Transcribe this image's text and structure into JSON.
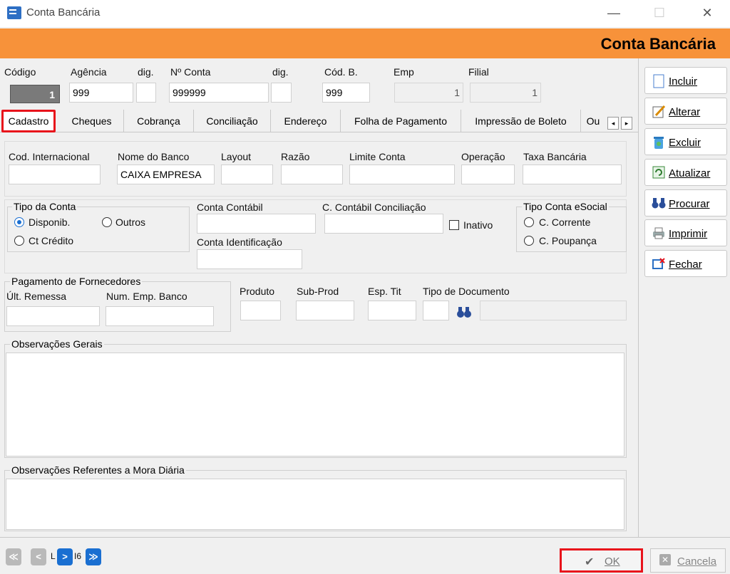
{
  "window": {
    "title": "Conta Bancária",
    "minimize": "—",
    "maximize": "☐",
    "close": "✕"
  },
  "banner": {
    "title": "Conta Bancária"
  },
  "header": {
    "codigo_label": "Código",
    "codigo_value": "1",
    "agencia_label": "Agência",
    "agencia_value": "999",
    "dig1_label": "dig.",
    "dig1_value": "",
    "conta_label": "Nº Conta",
    "conta_value": "999999",
    "dig2_label": "dig.",
    "dig2_value": "",
    "codb_label": "Cód. B.",
    "codb_value": "999",
    "emp_label": "Emp",
    "emp_value": "1",
    "filial_label": "Filial",
    "filial_value": "1"
  },
  "tabs": [
    "Cadastro",
    "Cheques",
    "Cobrança",
    "Conciliação",
    "Endereço",
    "Folha de Pagamento",
    "Impressão de Boleto",
    "Ou"
  ],
  "tab_scroll": {
    "left": "◂",
    "right": "▸"
  },
  "cadastro": {
    "cod_internacional_label": "Cod. Internacional",
    "cod_internacional_value": "",
    "nome_banco_label": "Nome do Banco",
    "nome_banco_value": "CAIXA EMPRESA",
    "layout_label": "Layout",
    "layout_value": "",
    "razao_label": "Razão",
    "razao_value": "",
    "limite_label": "Limite Conta",
    "limite_value": "",
    "operacao_label": "Operação",
    "operacao_value": "",
    "taxa_label": "Taxa Bancária",
    "taxa_value": "",
    "tipo_conta": {
      "caption": "Tipo da Conta",
      "opt1": "Disponib.",
      "opt2": "Outros",
      "opt3": "Ct Crédito"
    },
    "conta_contabil_label": "Conta Contábil",
    "conta_contabil_value": "",
    "conta_concil_label": "C. Contábil Conciliação",
    "conta_concil_value": "",
    "inativo_label": "Inativo",
    "conta_ident_label": "Conta Identificação",
    "conta_ident_value": "",
    "esocial": {
      "caption": "Tipo Conta eSocial",
      "opt1": "C. Corrente",
      "opt2": "C. Poupança"
    },
    "pagamento": {
      "caption": "Pagamento de Fornecedores",
      "ult_remessa": "Últ. Remessa",
      "num_emp": "Num. Emp. Banco"
    },
    "produto_label": "Produto",
    "subprod_label": "Sub-Prod",
    "esptit_label": "Esp. Tit",
    "tipodoc_label": "Tipo de Documento",
    "obs_gerais": "Observações Gerais",
    "obs_mora": "Observações Referentes a Mora Diária"
  },
  "side_buttons": [
    {
      "label": "Incluir",
      "icon": "page-icon"
    },
    {
      "label": "Alterar",
      "icon": "edit-icon"
    },
    {
      "label": "Excluir",
      "icon": "recycle-icon"
    },
    {
      "label": "Atualizar",
      "icon": "refresh-icon"
    },
    {
      "label": "Procurar",
      "icon": "binoculars-icon"
    },
    {
      "label": "Imprimir",
      "icon": "printer-icon"
    },
    {
      "label": "Fechar",
      "icon": "exit-icon"
    }
  ],
  "footer": {
    "ok": "OK",
    "cancela": "Cancela",
    "nav_first": "≪",
    "nav_prev": "<",
    "nav_next": ">",
    "nav_last": "≫",
    "nav_text_1": "L",
    "nav_text_2": "I6"
  }
}
